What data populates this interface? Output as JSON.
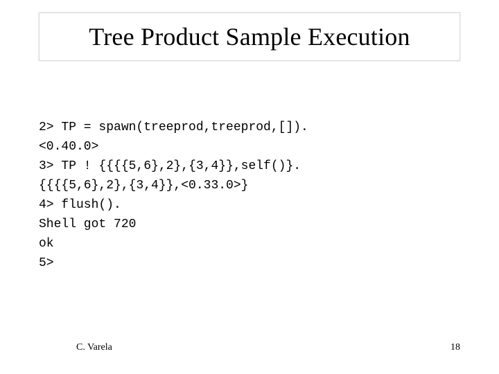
{
  "title": "Tree Product Sample Execution",
  "code": {
    "l1": "2> TP = spawn(treeprod,treeprod,[]).",
    "l2": "<0.40.0>",
    "l3": "3> TP ! {{{{5,6},2},{3,4}},self()}.",
    "l4": "{{{{5,6},2},{3,4}},<0.33.0>}",
    "l5": "4> flush().",
    "l6": "Shell got 720",
    "l7": "ok",
    "l8": "5>"
  },
  "footer": {
    "author": "C. Varela",
    "page": "18"
  }
}
